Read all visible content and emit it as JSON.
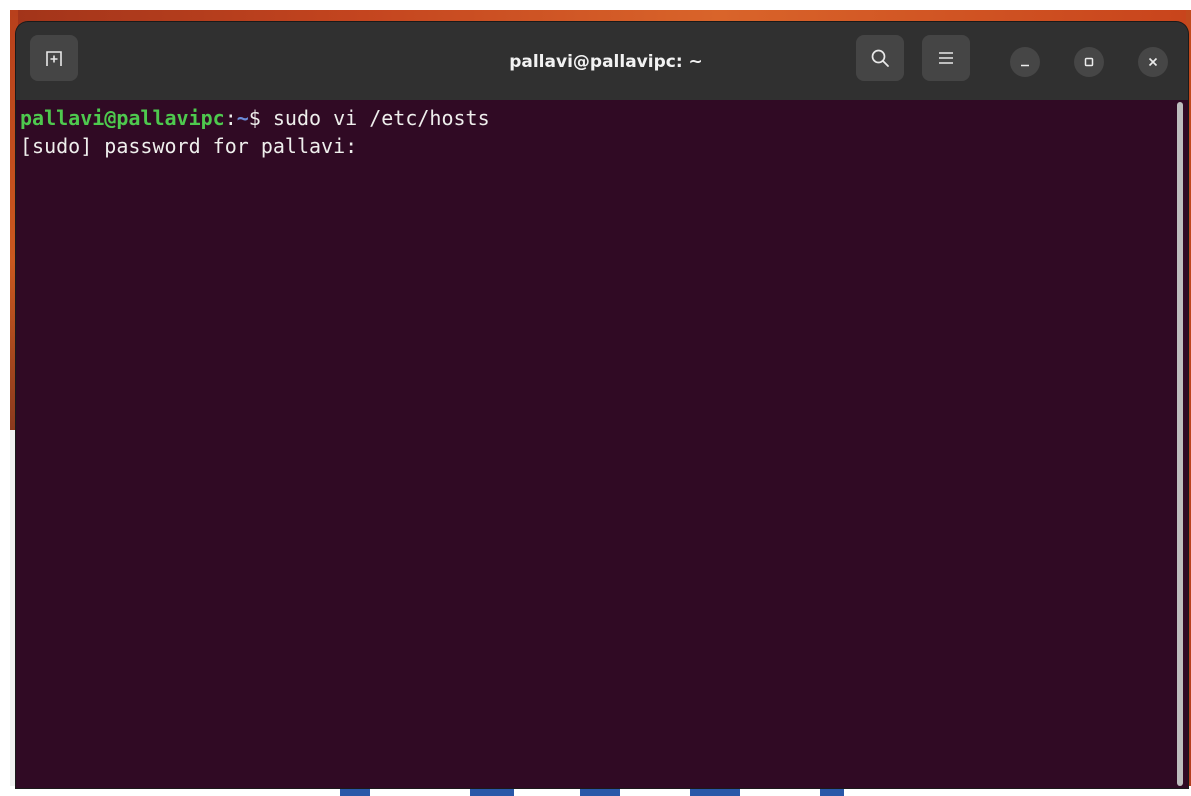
{
  "window": {
    "title": "pallavi@pallavipc: ~"
  },
  "headerbar": {
    "icons": {
      "new_tab": "new-tab-icon",
      "search": "search-icon",
      "menu": "hamburger-menu-icon",
      "minimize": "minimize-icon",
      "maximize": "maximize-icon",
      "close": "close-icon"
    }
  },
  "terminal": {
    "lines": [
      {
        "user_host": "pallavi@pallavipc",
        "separator": ":",
        "path": "~",
        "prompt_symbol": "$",
        "command": " sudo vi /etc/hosts"
      },
      {
        "text": "[sudo] password for pallavi:"
      }
    ]
  },
  "colors": {
    "terminal_background": "#300a24",
    "terminal_text": "#eeeeec",
    "prompt_user_host": "#4ec94e",
    "prompt_path": "#6b8cd9",
    "headerbar_background": "#303030"
  }
}
